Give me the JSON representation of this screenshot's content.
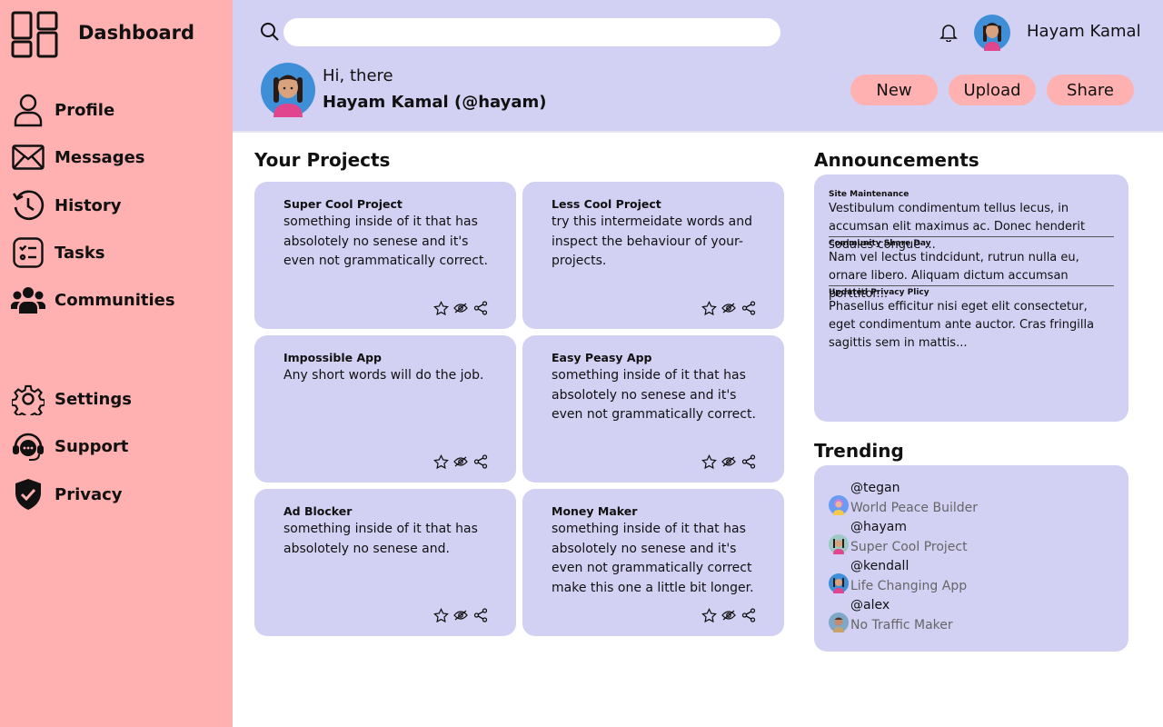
{
  "sidebar": {
    "title": "Dashboard",
    "items": [
      {
        "label": "Profile",
        "icon": "user-icon"
      },
      {
        "label": "Messages",
        "icon": "envelope-icon"
      },
      {
        "label": "History",
        "icon": "history-icon"
      },
      {
        "label": "Tasks",
        "icon": "tasks-icon"
      },
      {
        "label": "Communities",
        "icon": "users-icon"
      }
    ],
    "bottom_items": [
      {
        "label": "Settings",
        "icon": "gear-icon"
      },
      {
        "label": "Support",
        "icon": "headset-icon"
      },
      {
        "label": "Privacy",
        "icon": "shield-icon"
      }
    ]
  },
  "header": {
    "search": {
      "placeholder": "",
      "value": ""
    },
    "user_name": "Hayam Kamal",
    "greeting": "Hi, there",
    "greeting_name": "Hayam Kamal (@hayam)",
    "buttons": {
      "new": "New",
      "upload": "Upload",
      "share": "Share"
    }
  },
  "projects": {
    "title": "Your Projects",
    "cards": [
      {
        "title": "Super Cool Project",
        "desc": "something inside of it that has absolotely no senese and it's even not grammatically correct."
      },
      {
        "title": "Less Cool Project",
        "desc": "try this intermeidate words and inspect the behaviour of your-projects."
      },
      {
        "title": "Impossible App",
        "desc": "Any short words will do the job."
      },
      {
        "title": "Easy Peasy App",
        "desc": "something inside of it that has absolotely no senese and it's even not grammatically correct."
      },
      {
        "title": "Ad Blocker",
        "desc": "something inside of it that has absolotely no senese and."
      },
      {
        "title": "Money Maker",
        "desc": "something inside of it that has absolotely no senese and it's even not grammatically correct make this one a little bit longer."
      }
    ]
  },
  "announcements": {
    "title": "Announcements",
    "items": [
      {
        "title": "Site Maintenance",
        "text": "Vestibulum condimentum tellus lecus, in accumsan elit maximus ac. Donec henderit sodales congue ..."
      },
      {
        "title": "Community Share Day",
        "text": "Nam vel lectus tindcidunt, rutrun nulla eu, ornare libero. Aliquam dictum accumsan porttitor..."
      },
      {
        "title": "Updated Privacy Plicy",
        "text": "Phasellus efficitur nisi eget elit consectetur, eget condimentum ante auctor. Cras fringilla sagittis sem in mattis..."
      }
    ]
  },
  "trending": {
    "title": "Trending",
    "items": [
      {
        "handle": "@tegan",
        "project": "World Peace Builder"
      },
      {
        "handle": "@hayam",
        "project": "Super Cool Project"
      },
      {
        "handle": "@kendall",
        "project": "Life Changing App"
      },
      {
        "handle": "@alex",
        "project": "No Traffic Maker"
      }
    ]
  },
  "colors": {
    "sidebar": "#ffb0b0",
    "header": "#d2d1f3",
    "card": "#d2d1f3",
    "button": "#ffb0b0"
  }
}
